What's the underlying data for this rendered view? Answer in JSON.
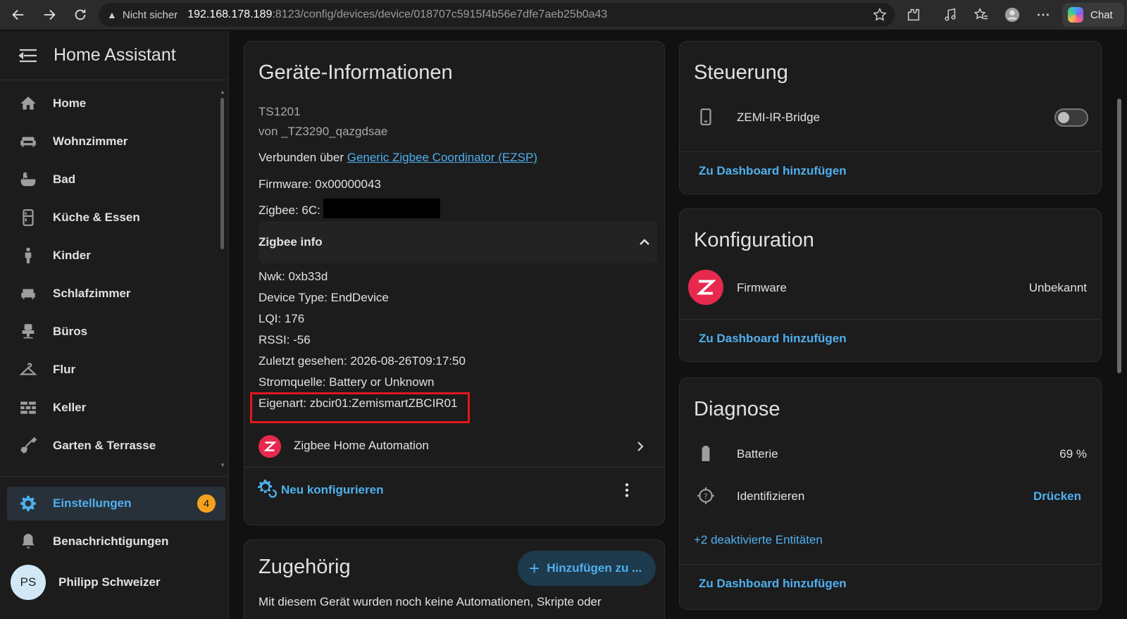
{
  "browser": {
    "security_warning": "Nicht sicher",
    "url_host": "192.168.178.189",
    "url_path": ":8123/config/devices/device/018707c5915f4b56e7dfe7aeb25b0a43",
    "chat_label": "Chat"
  },
  "sidebar": {
    "title": "Home Assistant",
    "items": [
      {
        "label": "Home",
        "icon": "home-icon"
      },
      {
        "label": "Wohnzimmer",
        "icon": "sofa-icon"
      },
      {
        "label": "Bad",
        "icon": "bathtub-icon"
      },
      {
        "label": "Küche & Essen",
        "icon": "fridge-icon"
      },
      {
        "label": "Kinder",
        "icon": "child-icon"
      },
      {
        "label": "Schlafzimmer",
        "icon": "bed-icon"
      },
      {
        "label": "Büros",
        "icon": "desk-chair-icon"
      },
      {
        "label": "Flur",
        "icon": "hanger-icon"
      },
      {
        "label": "Keller",
        "icon": "bricks-icon"
      },
      {
        "label": "Garten & Terrasse",
        "icon": "shovel-icon"
      }
    ],
    "settings": {
      "label": "Einstellungen",
      "badge": "4"
    },
    "notifications": {
      "label": "Benachrichtigungen"
    },
    "user": {
      "initials": "PS",
      "name": "Philipp Schweizer"
    }
  },
  "device_info": {
    "title": "Geräte-Informationen",
    "model": "TS1201",
    "manufacturer": "von _TZ3290_qazgdsae",
    "connected_prefix": "Verbunden über ",
    "connected_link": "Generic Zigbee Coordinator (EZSP)",
    "firmware": "Firmware: 0x00000043",
    "zigbee": "Zigbee: 6C:",
    "zigbee_info_header": "Zigbee info",
    "zigbee_info": [
      "Nwk: 0xb33d",
      "Device Type: EndDevice",
      "LQI: 176",
      "RSSI: -56",
      "Zuletzt gesehen: 2026-08-26T09:17:50",
      "Stromquelle: Battery or Unknown",
      "Eigenart: zbcir01:ZemismartZBCIR01"
    ],
    "integration": "Zigbee Home Automation",
    "reconfigure": "Neu konfigurieren"
  },
  "related": {
    "title": "Zugehörig",
    "add_button": "Hinzufügen zu ...",
    "text": "Mit diesem Gerät wurden noch keine Automationen, Skripte oder"
  },
  "control": {
    "title": "Steuerung",
    "entity": "ZEMI-IR-Bridge",
    "toggle_on": false,
    "add_dashboard": "Zu Dashboard hinzufügen"
  },
  "config": {
    "title": "Konfiguration",
    "entity": "Firmware",
    "state": "Unbekannt",
    "add_dashboard": "Zu Dashboard hinzufügen"
  },
  "diagnostics": {
    "title": "Diagnose",
    "battery_label": "Batterie",
    "battery_value": "69 %",
    "identify_label": "Identifizieren",
    "identify_button": "Drücken",
    "disabled_entities": "+2 deaktivierte Entitäten",
    "add_dashboard": "Zu Dashboard hinzufügen"
  },
  "colors": {
    "accent": "#4fb0ee",
    "badge": "#f4a21e",
    "zha": "#e8294e",
    "highlight": "#e0161f"
  }
}
